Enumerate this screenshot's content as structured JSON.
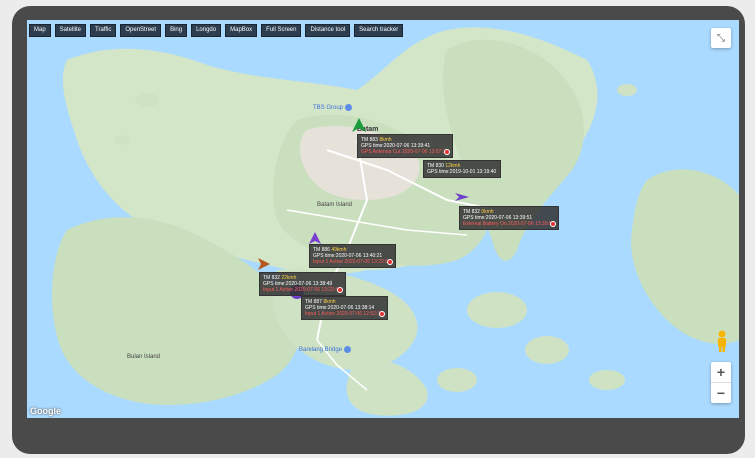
{
  "toolbar": {
    "buttons": [
      "Map",
      "Satellite",
      "Traffic",
      "OpenStreet",
      "Bing",
      "Longdo",
      "MapBox",
      "Full Screen",
      "Distance tool",
      "Search tracker"
    ]
  },
  "map": {
    "places": {
      "batam": "Batam",
      "batam_island": "Batam Island",
      "bulan_island": "Bulan Island"
    },
    "pois": {
      "tbs_group": "TBS Group",
      "barelang_bridge": "Barelang Bridge"
    },
    "attribution": "Google"
  },
  "trackers": [
    {
      "name": "TM 883",
      "speed": "8kmh",
      "gps": "GPS time:2020-07-06 13:39:41",
      "alert": "GPS Antenna Cut 2020-07-06 13:07:26",
      "marker_color": "#1a9c3c"
    },
    {
      "name": "TM 830",
      "speed": "12kmh",
      "gps": "GPS time:2019-10-01 13:19:40",
      "alert": "",
      "marker_color": "#888888"
    },
    {
      "name": "TM 832",
      "speed": "0kmh",
      "gps": "GPS time:2020-07-06 13:39:51",
      "alert": "External Battery On 2020-07-06 13:39:51",
      "marker_color": "#6b3fc7"
    },
    {
      "name": "TM 886",
      "speed": "49kmh",
      "gps": "GPS time:2020-07-06 13:40:21",
      "alert": "Input 1 Active 2020-07-06 13:22:09",
      "marker_color": "#7a3fd1"
    },
    {
      "name": "TM 832",
      "speed": "22kmh",
      "gps": "GPS time:2020-07-06 13:38:49",
      "alert": "Input 1 Active 2020-07-06 13:22:41",
      "marker_color": "#b45a1e"
    },
    {
      "name": "TM 887",
      "speed": "8kmh",
      "gps": "GPS time:2020-07-06 13:38:14",
      "alert": "Input 1 Active 2020-07-06 12:52:32",
      "marker_color": "#6b3fc7"
    }
  ]
}
